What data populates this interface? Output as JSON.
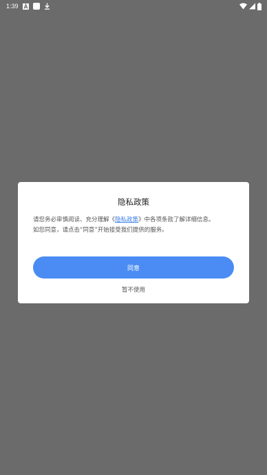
{
  "status_bar": {
    "time": "1:39",
    "icons": [
      "a-letter-icon",
      "white-square-icon",
      "download-icon",
      "wifi-icon",
      "signal-icon",
      "battery-icon"
    ]
  },
  "dialog": {
    "title": "隐私政策",
    "body_part1": "请您务必审慎阅读、充分理解《",
    "policy_link": "隐私政策",
    "body_part2": "》中各项条款了解详细信息。",
    "body_line2": "如您同意，请点击“同意”开始接受我们提供的服务。",
    "agree_button": "同意",
    "decline_link": "暂不使用"
  },
  "colors": {
    "overlay": "#6b6b6b",
    "primary": "#4a8cf3",
    "link": "#3a7fe6"
  }
}
